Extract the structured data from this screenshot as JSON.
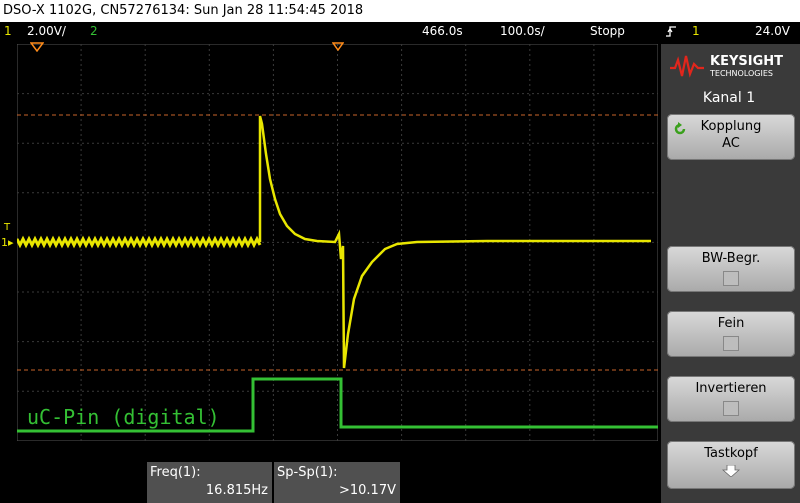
{
  "title": "DSO-X 1102G, CN57276134: Sun Jan 28 11:54:45 2018",
  "status": {
    "ch1_num": "1",
    "ch1_scale": "2.00V/",
    "ch2_num": "2",
    "time_pos": "466.0s",
    "time_scale": "100.0s/",
    "run_state": "Stopp",
    "trig_icon": "trigger-edge-icon",
    "trig_source": "1",
    "trig_level": "24.0V"
  },
  "brand": {
    "name": "KEYSIGHT",
    "sub": "TECHNOLOGIES"
  },
  "menu": {
    "title": "Kanal 1",
    "kopplung_label": "Kopplung",
    "kopplung_value": "AC",
    "bw_label": "BW-Begr.",
    "fein_label": "Fein",
    "invert_label": "Invertieren",
    "tastkopf_label": "Tastkopf"
  },
  "ch2_label": "uC-Pin (digital)",
  "measurements": [
    {
      "label": "Freq(1):",
      "value": "16.815Hz"
    },
    {
      "label": "Sp-Sp(1):",
      "value": ">10.17V"
    }
  ],
  "colors": {
    "ch1": "#e8e600",
    "ch2": "#34c034",
    "cursor": "#c8642a",
    "grid": "#3c3c3c"
  }
}
